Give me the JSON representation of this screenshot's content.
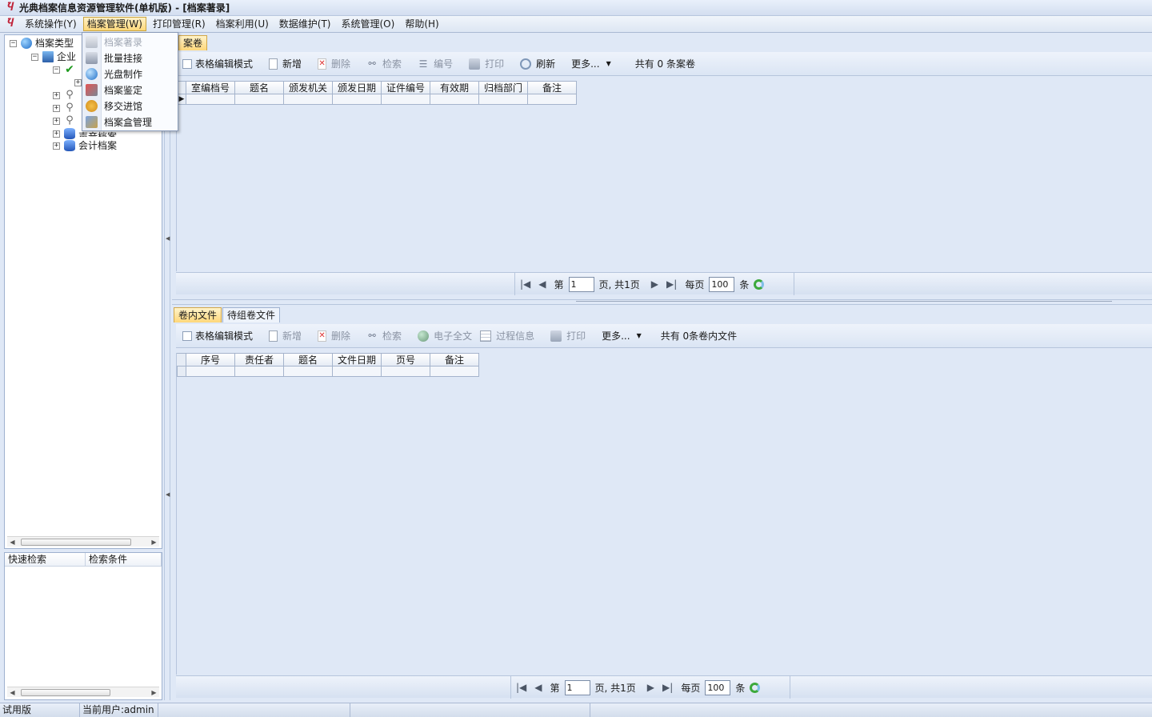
{
  "window": {
    "title": "光典档案信息资源管理软件(单机版) - [档案著录]",
    "app_icon": "Ⴏ"
  },
  "menubar": {
    "items": [
      {
        "label": "系统操作(Y)"
      },
      {
        "label": "档案管理(W)"
      },
      {
        "label": "打印管理(R)"
      },
      {
        "label": "档案利用(U)"
      },
      {
        "label": "数据维护(T)"
      },
      {
        "label": "系统管理(O)"
      },
      {
        "label": "帮助(H)"
      }
    ],
    "active_index": 1
  },
  "dropdown": {
    "items": [
      {
        "label": "档案著录",
        "icon": "book-icon",
        "disabled": true
      },
      {
        "label": "批量挂接",
        "icon": "link-icon",
        "disabled": false
      },
      {
        "label": "光盘制作",
        "icon": "disc-icon",
        "disabled": false
      },
      {
        "label": "档案鉴定",
        "icon": "stamp-icon",
        "disabled": false
      },
      {
        "label": "移交进馆",
        "icon": "hand-icon",
        "disabled": false
      },
      {
        "label": "档案盒管理",
        "icon": "box-icon",
        "disabled": false
      }
    ]
  },
  "tree": {
    "root_label": "档案类型",
    "node_enterprise_label": "企业",
    "partially_hidden_label": "声音档案",
    "accounting_label": "会计档案",
    "toggle_minus": "−",
    "toggle_plus": "+",
    "check_glyph": "✔",
    "clip_glyph": "⚲"
  },
  "quick_search": {
    "col1": "快速检索",
    "col2": "检索条件"
  },
  "top_panel": {
    "tab_label": "案卷",
    "toolbar": {
      "grid_edit_mode": "表格编辑模式",
      "new": "新增",
      "delete": "删除",
      "search": "检索",
      "number": "编号",
      "print": "打印",
      "refresh": "刷新",
      "more": "更多...",
      "count_text": "共有 0 条案卷"
    },
    "columns": [
      "室编档号",
      "题名",
      "颁发机关",
      "颁发日期",
      "证件编号",
      "有效期",
      "归档部门",
      "备注"
    ],
    "pager": {
      "page_prefix": "第",
      "page_value": "1",
      "page_suffix": "页, 共1页",
      "per_page_label": "每页",
      "per_page_value": "100",
      "unit": "条"
    }
  },
  "bottom_panel": {
    "tabs": [
      "卷内文件",
      "待组卷文件"
    ],
    "active_tab": 0,
    "toolbar": {
      "grid_edit_mode": "表格编辑模式",
      "new": "新增",
      "delete": "删除",
      "search": "检索",
      "fulltext": "电子全文",
      "process_info": "过程信息",
      "print": "打印",
      "more": "更多...",
      "count_text": "共有 0条卷内文件"
    },
    "columns": [
      "序号",
      "责任者",
      "题名",
      "文件日期",
      "页号",
      "备注"
    ],
    "pager": {
      "page_prefix": "第",
      "page_value": "1",
      "page_suffix": "页, 共1页",
      "per_page_label": "每页",
      "per_page_value": "100",
      "unit": "条"
    }
  },
  "statusbar": {
    "edition": "试用版",
    "current_user": "当前用户:admin"
  },
  "glyphs": {
    "first": "|◀",
    "prev": "◀",
    "next": "▶",
    "last": "▶|",
    "caret": "▼",
    "row_pointer": "▶",
    "scroll_left": "◀",
    "scroll_right": "▶",
    "grip_left": "◀",
    "grip_up": "▲",
    "bino": "⚯",
    "list": "☰",
    "x": "✕"
  }
}
